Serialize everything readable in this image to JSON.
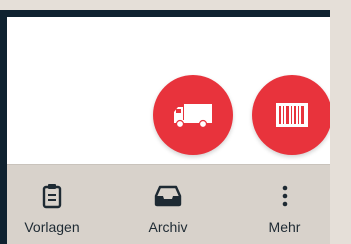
{
  "actions": [
    {
      "id": "truck",
      "icon": "truck-icon",
      "color": "#e8333c"
    },
    {
      "id": "barcode",
      "icon": "barcode-icon",
      "color": "#e8333c"
    }
  ],
  "bottom_nav": {
    "items": [
      {
        "label": "Vorlagen",
        "icon": "clipboard-icon"
      },
      {
        "label": "Archiv",
        "icon": "inbox-tray-icon"
      },
      {
        "label": "Mehr",
        "icon": "more-vertical-icon"
      }
    ]
  },
  "colors": {
    "accent": "#e8333c",
    "nav_background": "#d8d2cb",
    "frame": "#0f2230"
  }
}
